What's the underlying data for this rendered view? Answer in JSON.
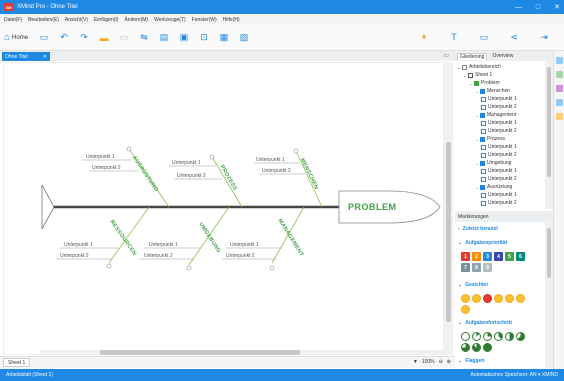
{
  "window": {
    "title": "XMind Pro - Ohne Titel",
    "app_icon": "XM",
    "controls": [
      "—",
      "□",
      "✕"
    ]
  },
  "menu": [
    "Datei(F)",
    "Bearbeiten(E)",
    "Ansicht(V)",
    "Einfügen(I)",
    "Ändern(M)",
    "Werkzeuge(T)",
    "Fenster(W)",
    "Hilfe(H)"
  ],
  "toolbar": {
    "home_label": "Home"
  },
  "document": {
    "tab_label": "Ohne Titel",
    "tab_close": "✕"
  },
  "diagram": {
    "problem": "PROBLEM",
    "categories": [
      "AUSRÜSTUNG",
      "PROZESS",
      "MENSCHEN",
      "RESSOURCEN",
      "UMGEBUNG",
      "MANAGEMENT"
    ],
    "subpoint_1": "Unterpunkt 1",
    "subpoint_2": "Unterpunkt 2"
  },
  "sheet": {
    "tab_label": "Sheet 1",
    "zoom": "100%"
  },
  "status": {
    "left": "Arbeitsblatt (Sheet 1)",
    "right": "Automatisches Speichern: AN ▾  XMIND"
  },
  "outline": {
    "tabs": [
      "Gliederung",
      "Overview"
    ],
    "items": [
      {
        "label": "Arbeitsbereich",
        "level": 0,
        "icon": "page"
      },
      {
        "label": "Sheet 1",
        "level": 1,
        "icon": "grid"
      },
      {
        "label": "Problem",
        "level": 2,
        "icon": "green"
      },
      {
        "label": "Menschen",
        "level": 3,
        "icon": "blue"
      },
      {
        "label": "Unterpunkt 1",
        "level": 4,
        "icon": "outline"
      },
      {
        "label": "Unterpunkt 2",
        "level": 4,
        "icon": "outline"
      },
      {
        "label": "Management",
        "level": 3,
        "icon": "blue"
      },
      {
        "label": "Unterpunkt 1",
        "level": 4,
        "icon": "outline"
      },
      {
        "label": "Unterpunkt 2",
        "level": 4,
        "icon": "outline"
      },
      {
        "label": "Prozess",
        "level": 3,
        "icon": "blue"
      },
      {
        "label": "Unterpunkt 1",
        "level": 4,
        "icon": "outline"
      },
      {
        "label": "Unterpunkt 2",
        "level": 4,
        "icon": "outline"
      },
      {
        "label": "Umgebung",
        "level": 3,
        "icon": "blue"
      },
      {
        "label": "Unterpunkt 1",
        "level": 4,
        "icon": "outline"
      },
      {
        "label": "Unterpunkt 2",
        "level": 4,
        "icon": "outline"
      },
      {
        "label": "Ausrüstung",
        "level": 3,
        "icon": "blue"
      },
      {
        "label": "Unterpunkt 1",
        "level": 4,
        "icon": "outline"
      },
      {
        "label": "Unterpunkt 2",
        "level": 4,
        "icon": "outline"
      }
    ]
  },
  "markers": {
    "title": "Markierungen",
    "sections": {
      "recent": "Zuletzt benutzt",
      "priority": "Aufgabenpriorität",
      "faces": "Gesichter",
      "progress": "Aufgabenfortschritt",
      "flags": "Flaggen"
    },
    "priorities": [
      {
        "n": "1",
        "color": "#e53935"
      },
      {
        "n": "2",
        "color": "#fb8c00"
      },
      {
        "n": "3",
        "color": "#1e88e5"
      },
      {
        "n": "4",
        "color": "#3949ab"
      },
      {
        "n": "5",
        "color": "#43a047"
      },
      {
        "n": "6",
        "color": "#00897b"
      },
      {
        "n": "7",
        "color": "#78909c"
      },
      {
        "n": "8",
        "color": "#90a4ae"
      },
      {
        "n": "9",
        "color": "#b0bec5"
      }
    ],
    "face_count": 7,
    "progress_levels": [
      0,
      0.125,
      0.25,
      0.375,
      0.5,
      0.625,
      0.75,
      0.875,
      1
    ]
  },
  "colors": {
    "accent": "#1e88e5",
    "diagram_green": "#43a047"
  }
}
